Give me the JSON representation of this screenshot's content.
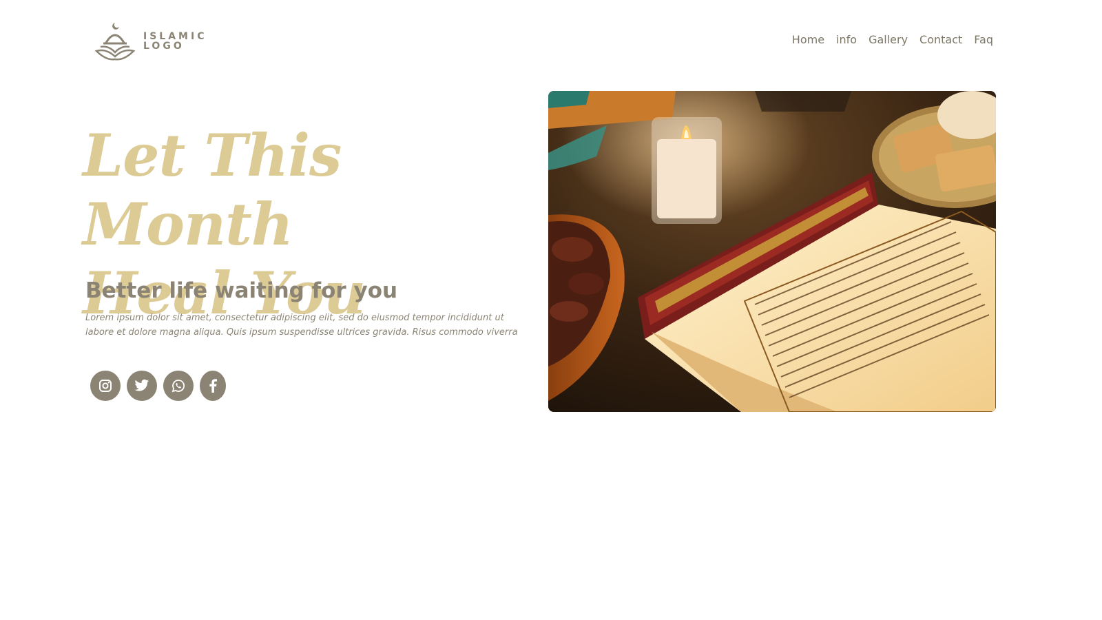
{
  "logo": {
    "line1": "ISLAMIC",
    "line2": "LOGO",
    "icon": "mosque-crescent-icon"
  },
  "nav": {
    "items": [
      {
        "label": "Home"
      },
      {
        "label": "info"
      },
      {
        "label": "Gallery"
      },
      {
        "label": "Contact"
      },
      {
        "label": "Faq"
      }
    ]
  },
  "hero": {
    "title_line1": "Let This Month",
    "title_line2": "Heal You",
    "subtitle": "Better life waiting for you",
    "paragraph": "Lorem ipsum dolor sit amet, consectetur adipiscing elit, sed do eiusmod tempor incididunt ut labore et dolore magna aliqua. Quis ipsum suspendisse ultrices gravida. Risus commodo viverra"
  },
  "socials": [
    {
      "icon": "instagram-icon"
    },
    {
      "icon": "twitter-icon"
    },
    {
      "icon": "whatsapp-icon"
    },
    {
      "icon": "facebook-icon"
    }
  ],
  "colors": {
    "accent_gold": "#dccb95",
    "text_brown": "#8b8474",
    "nav_text": "#7d7766",
    "background": "#ffffff"
  }
}
